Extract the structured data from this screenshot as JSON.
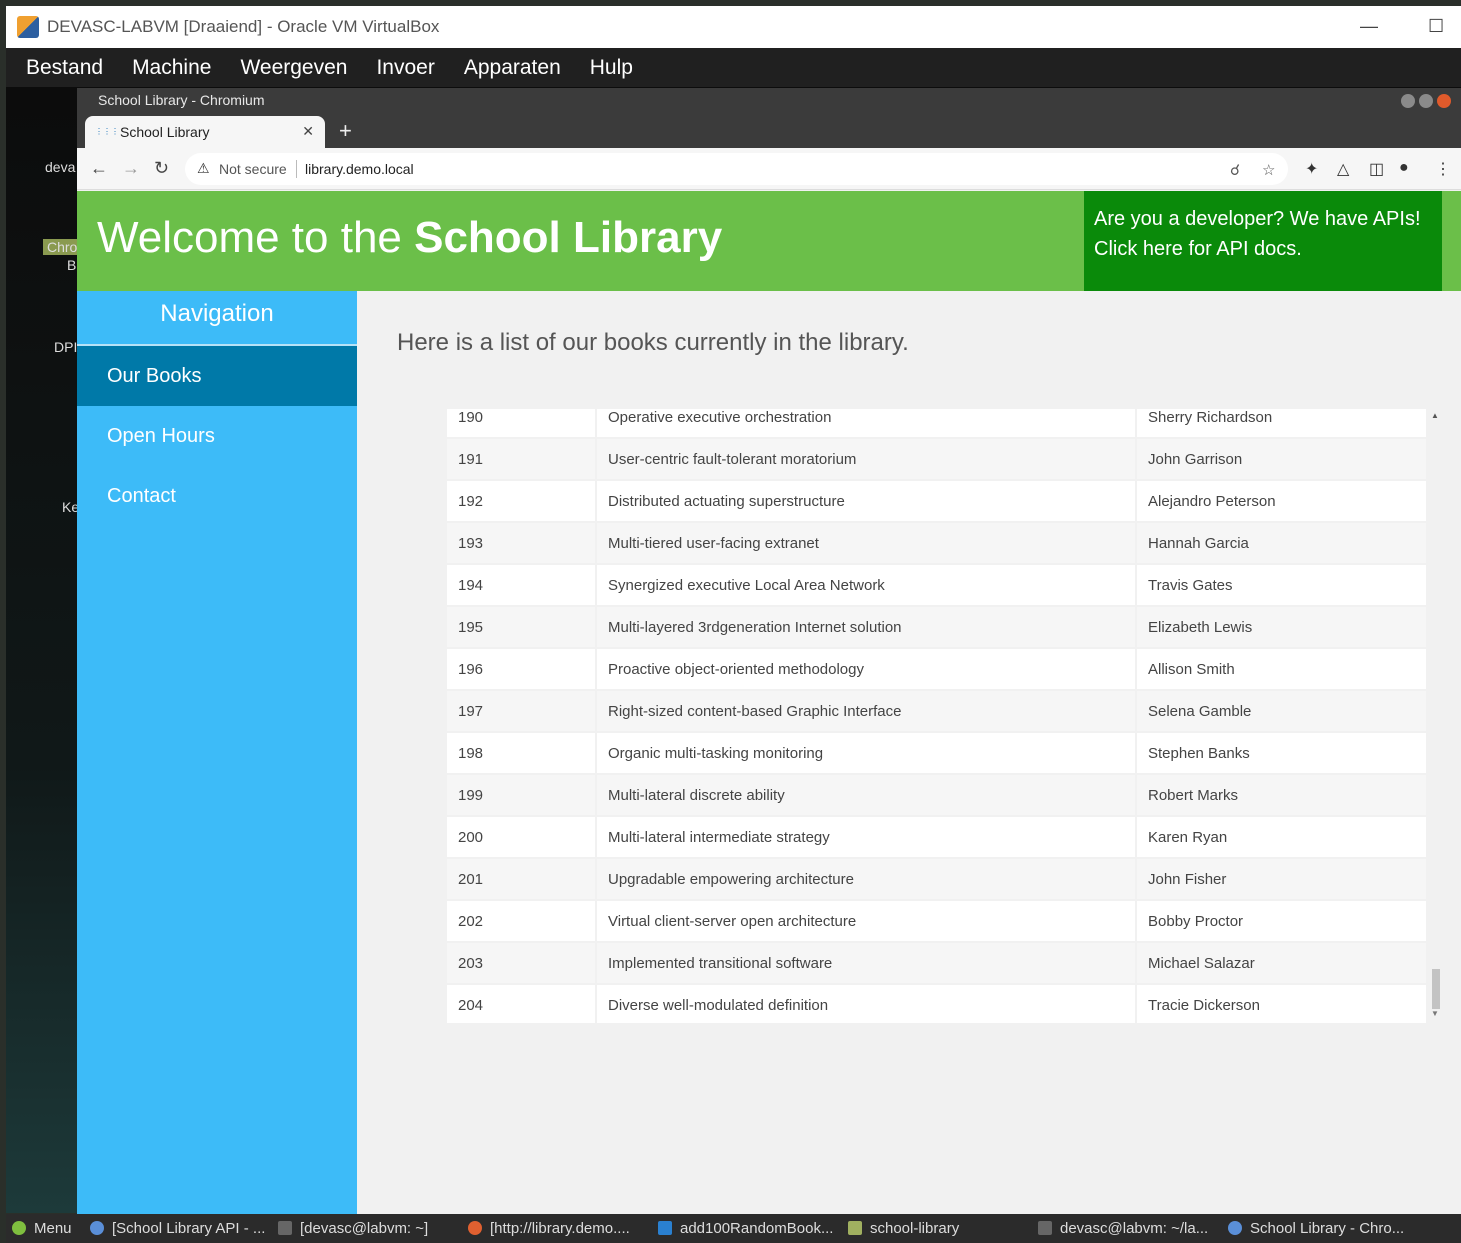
{
  "vbox": {
    "title": "DEVASC-LABVM [Draaiend] - Oracle VM VirtualBox",
    "menu": [
      "Bestand",
      "Machine",
      "Weergeven",
      "Invoer",
      "Apparaten",
      "Hulp"
    ]
  },
  "desktop": {
    "icons": [
      "deva",
      "Chro",
      "B",
      "DPI",
      "Ke"
    ]
  },
  "chromium": {
    "window_title": "School Library - Chromium",
    "tab_title": "School Library",
    "address": {
      "security_label": "Not secure",
      "url": "library.demo.local"
    }
  },
  "site": {
    "title_prefix": "Welcome to the ",
    "title_bold": "School Library",
    "api_line1": "Are you a developer? We have APIs!",
    "api_line2": "Click here for API docs.",
    "nav_heading": "Navigation",
    "nav_items": [
      "Our Books",
      "Open Hours",
      "Contact"
    ],
    "intro": "Here is a list of our books currently in the library."
  },
  "books": [
    {
      "id": "190",
      "title": "Operative executive orchestration",
      "author": "Sherry Richardson"
    },
    {
      "id": "191",
      "title": "User-centric fault-tolerant moratorium",
      "author": "John Garrison"
    },
    {
      "id": "192",
      "title": "Distributed actuating superstructure",
      "author": "Alejandro Peterson"
    },
    {
      "id": "193",
      "title": "Multi-tiered user-facing extranet",
      "author": "Hannah Garcia"
    },
    {
      "id": "194",
      "title": "Synergized executive Local Area Network",
      "author": "Travis Gates"
    },
    {
      "id": "195",
      "title": "Multi-layered 3rdgeneration Internet solution",
      "author": "Elizabeth Lewis"
    },
    {
      "id": "196",
      "title": "Proactive object-oriented methodology",
      "author": "Allison Smith"
    },
    {
      "id": "197",
      "title": "Right-sized content-based Graphic Interface",
      "author": "Selena Gamble"
    },
    {
      "id": "198",
      "title": "Organic multi-tasking monitoring",
      "author": "Stephen Banks"
    },
    {
      "id": "199",
      "title": "Multi-lateral discrete ability",
      "author": "Robert Marks"
    },
    {
      "id": "200",
      "title": "Multi-lateral intermediate strategy",
      "author": "Karen Ryan"
    },
    {
      "id": "201",
      "title": "Upgradable empowering architecture",
      "author": "John Fisher"
    },
    {
      "id": "202",
      "title": "Virtual client-server open architecture",
      "author": "Bobby Proctor"
    },
    {
      "id": "203",
      "title": "Implemented transitional software",
      "author": "Michael Salazar"
    },
    {
      "id": "204",
      "title": "Diverse well-modulated definition",
      "author": "Tracie Dickerson"
    }
  ],
  "taskbar": {
    "menu_label": "Menu",
    "items": [
      "[School Library API - ...",
      "[devasc@labvm: ~]",
      "[http://library.demo....",
      "add100RandomBook...",
      "school-library",
      "devasc@labvm: ~/la...",
      "School Library - Chro..."
    ]
  },
  "colors": {
    "header_green": "#6bbf49",
    "api_green": "#0a8a0a",
    "sidebar_blue": "#3dbbf8",
    "nav_active": "#0079a8"
  }
}
